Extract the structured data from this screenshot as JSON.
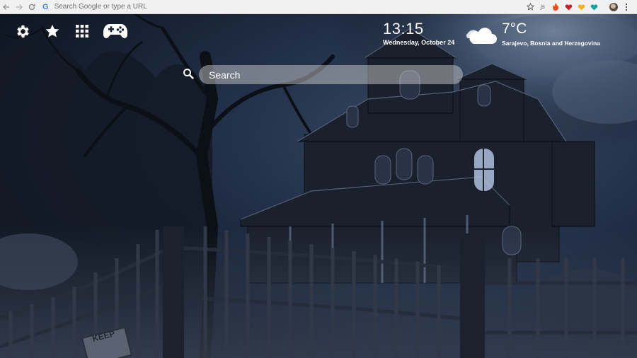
{
  "browser": {
    "omnibox_placeholder": "Search Google or type a URL",
    "google_g": "G",
    "extensions": [
      {
        "name": "bookmark-star-icon"
      },
      {
        "name": "extension-js-icon",
        "label": "js"
      },
      {
        "name": "extension-flame-icon",
        "color": "#e8501f"
      },
      {
        "name": "extension-heart-icon",
        "color": "#c4232b"
      },
      {
        "name": "extension-heart-gold-icon",
        "color": "#f0b323"
      },
      {
        "name": "extension-heart-teal-icon",
        "color": "#16a39a"
      }
    ]
  },
  "toolbar_icons": [
    "settings-gear-icon",
    "favorites-star-icon",
    "apps-grid-icon",
    "games-gamepad-icon"
  ],
  "clock": {
    "time": "13:15",
    "date": "Wednesday, October 24"
  },
  "weather": {
    "icon": "cloudy-icon",
    "temperature": "7°C",
    "location": "Sarajevo, Bosnia and Herzegovina"
  },
  "search": {
    "placeholder": "Search"
  },
  "wallpaper": {
    "sign_text": "KEEP",
    "colors": {
      "sky": "#2a3a55",
      "dark": "#0a0f18",
      "fence": "#1b202a"
    }
  }
}
